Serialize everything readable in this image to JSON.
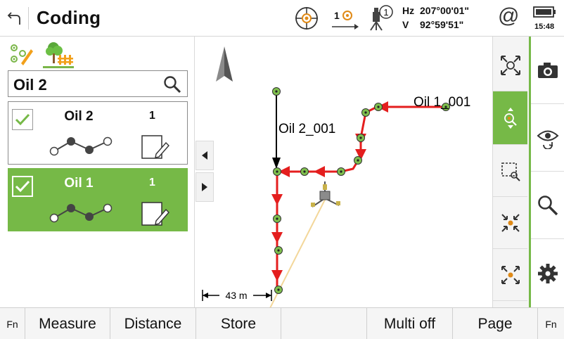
{
  "header": {
    "title": "Coding",
    "prism_number": "1",
    "hz_label": "Hz",
    "hz_value": "207°00'01\"",
    "v_label": "V",
    "v_value": "92°59'51\"",
    "time": "15:48",
    "at_symbol": "@",
    "icons": [
      "back-icon",
      "reflector-target-icon",
      "prism-icon",
      "robot-instrument-icon",
      "battery-icon"
    ]
  },
  "left_panel": {
    "search_value": "Oil 2",
    "codes": [
      {
        "name": "Oil 2",
        "count": "1",
        "checked": true,
        "selected": false
      },
      {
        "name": "Oil 1",
        "count": "1",
        "checked": true,
        "selected": true
      }
    ]
  },
  "map": {
    "labels": {
      "oil2": "Oil 2_001",
      "oil1": "Oil 1_001"
    },
    "scale": "43 m"
  },
  "right_toolbar": {
    "icons": [
      "fit-all-icon",
      "zoom-to-target-icon",
      "zoom-window-icon",
      "zoom-in-icon",
      "zoom-out-icon"
    ],
    "side_icons": [
      "camera-icon",
      "view-icon",
      "search-icon",
      "settings-gear-icon"
    ]
  },
  "softkeys": [
    "Fn",
    "Measure",
    "Distance",
    "Store",
    "",
    "Multi off",
    "Page",
    "Fn"
  ],
  "colors": {
    "accent_green": "#76b947",
    "line_red": "#e41e1e",
    "line_black": "#000000",
    "orange": "#f2a01a"
  }
}
